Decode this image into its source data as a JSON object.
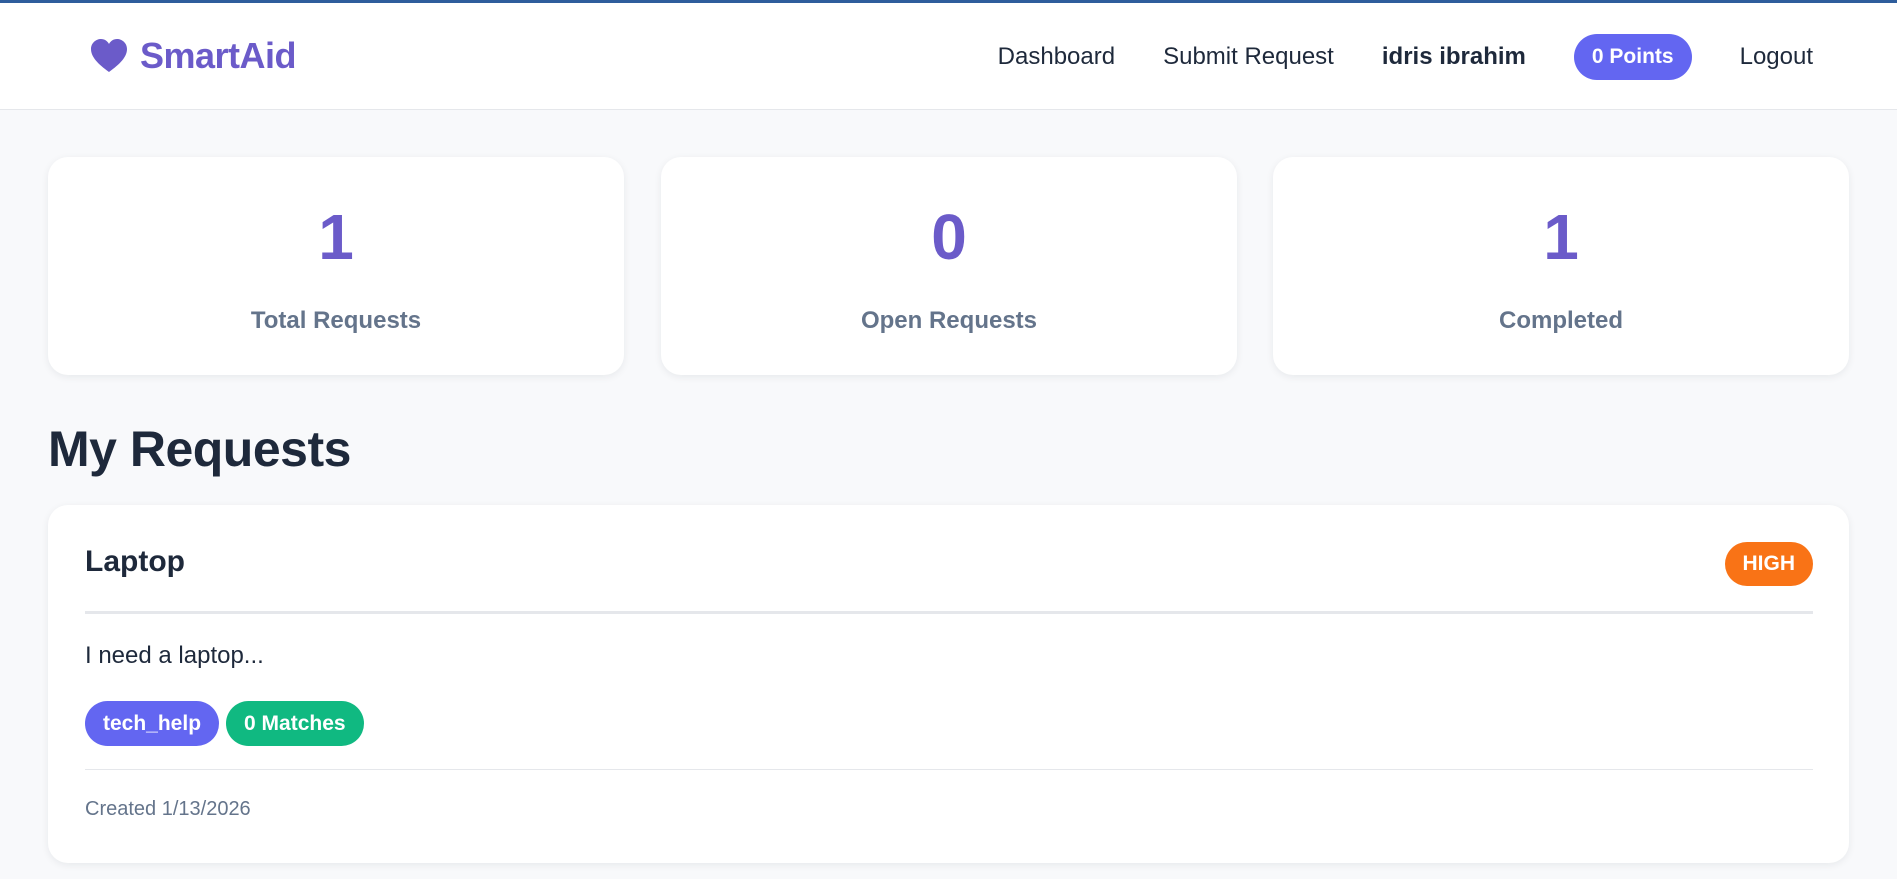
{
  "header": {
    "brand": "SmartAid",
    "nav": {
      "dashboard": "Dashboard",
      "submit_request": "Submit Request",
      "user_name": "idris ibrahim",
      "points": "0 Points",
      "logout": "Logout"
    }
  },
  "stats": [
    {
      "value": "1",
      "label": "Total Requests"
    },
    {
      "value": "0",
      "label": "Open Requests"
    },
    {
      "value": "1",
      "label": "Completed"
    }
  ],
  "requests_section": {
    "title": "My Requests",
    "items": [
      {
        "title": "Laptop",
        "priority": "HIGH",
        "description": "I need a laptop...",
        "category": "tech_help",
        "matches": "0 Matches",
        "created": "Created 1/13/2026"
      }
    ]
  },
  "colors": {
    "brand": "#6b5bc9",
    "accent": "#6366f1",
    "priority_high": "#f97316",
    "matches": "#10b981",
    "top_line": "#2e5d9c"
  },
  "icons": {
    "brand": "heart-icon"
  }
}
